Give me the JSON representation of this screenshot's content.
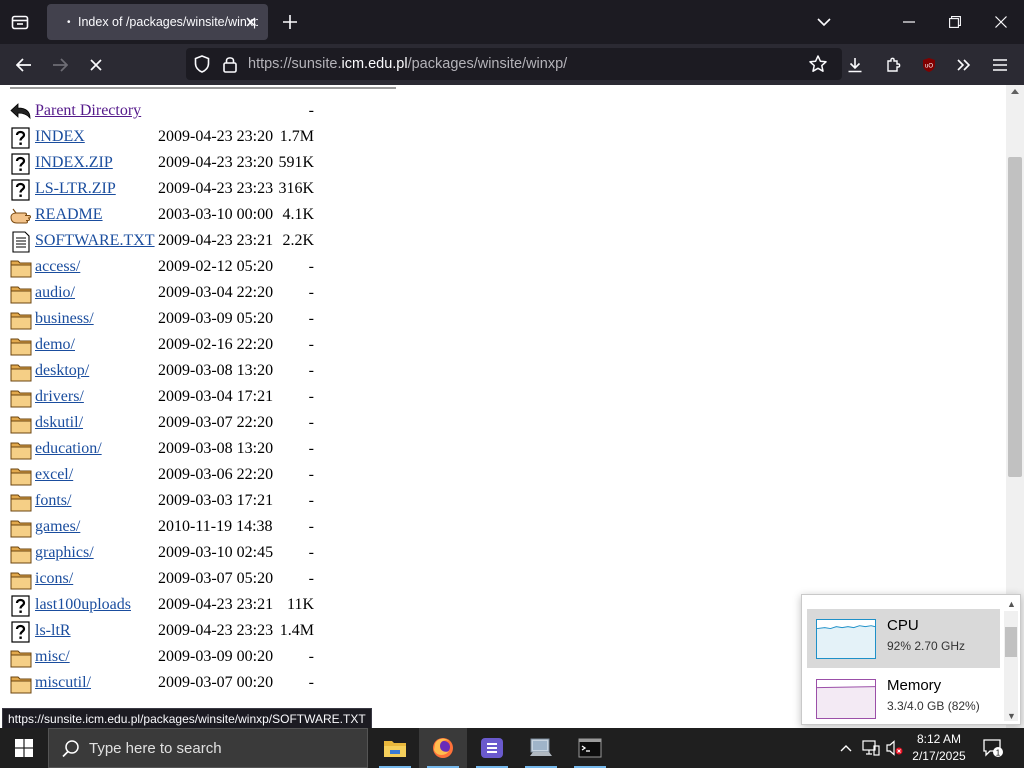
{
  "browser": {
    "tab_title": "Index of /packages/winsite/winxp/",
    "url_prefix": "https://sunsite.",
    "url_host": "icm.edu.pl",
    "url_path": "/packages/winsite/winxp/",
    "status_link": "https://sunsite.icm.edu.pl/packages/winsite/winxp/SOFTWARE.TXT"
  },
  "listing": {
    "parent_label": "Parent Directory",
    "parent_size": "-",
    "rows": [
      {
        "icon": "unknown",
        "name": "INDEX",
        "date": "2009-04-23 23:20",
        "size": "1.7M"
      },
      {
        "icon": "unknown",
        "name": "INDEX.ZIP",
        "date": "2009-04-23 23:20",
        "size": "591K"
      },
      {
        "icon": "unknown",
        "name": "LS-LTR.ZIP",
        "date": "2009-04-23 23:23",
        "size": "316K"
      },
      {
        "icon": "hand",
        "name": "README",
        "date": "2003-03-10 00:00",
        "size": "4.1K"
      },
      {
        "icon": "text",
        "name": "SOFTWARE.TXT",
        "date": "2009-04-23 23:21",
        "size": "2.2K"
      },
      {
        "icon": "folder",
        "name": "access/",
        "date": "2009-02-12 05:20",
        "size": "-"
      },
      {
        "icon": "folder",
        "name": "audio/",
        "date": "2009-03-04 22:20",
        "size": "-"
      },
      {
        "icon": "folder",
        "name": "business/",
        "date": "2009-03-09 05:20",
        "size": "-"
      },
      {
        "icon": "folder",
        "name": "demo/",
        "date": "2009-02-16 22:20",
        "size": "-"
      },
      {
        "icon": "folder",
        "name": "desktop/",
        "date": "2009-03-08 13:20",
        "size": "-"
      },
      {
        "icon": "folder",
        "name": "drivers/",
        "date": "2009-03-04 17:21",
        "size": "-"
      },
      {
        "icon": "folder",
        "name": "dskutil/",
        "date": "2009-03-07 22:20",
        "size": "-"
      },
      {
        "icon": "folder",
        "name": "education/",
        "date": "2009-03-08 13:20",
        "size": "-"
      },
      {
        "icon": "folder",
        "name": "excel/",
        "date": "2009-03-06 22:20",
        "size": "-"
      },
      {
        "icon": "folder",
        "name": "fonts/",
        "date": "2009-03-03 17:21",
        "size": "-"
      },
      {
        "icon": "folder",
        "name": "games/",
        "date": "2010-11-19 14:38",
        "size": "-"
      },
      {
        "icon": "folder",
        "name": "graphics/",
        "date": "2009-03-10 02:45",
        "size": "-"
      },
      {
        "icon": "folder",
        "name": "icons/",
        "date": "2009-03-07 05:20",
        "size": "-"
      },
      {
        "icon": "unknown",
        "name": "last100uploads",
        "date": "2009-04-23 23:21",
        "size": "11K"
      },
      {
        "icon": "unknown",
        "name": "ls-ltR",
        "date": "2009-04-23 23:23",
        "size": "1.4M"
      },
      {
        "icon": "folder",
        "name": "misc/",
        "date": "2009-03-09 00:20",
        "size": "-"
      },
      {
        "icon": "folder",
        "name": "miscutil/",
        "date": "2009-03-07 00:20",
        "size": "-"
      }
    ]
  },
  "perf": {
    "cpu_title": "CPU",
    "cpu_sub": "92%  2.70 GHz",
    "cpu_color": "#1e90c8",
    "mem_title": "Memory",
    "mem_sub": "3.3/4.0 GB (82%)",
    "mem_color": "#9b4fa8"
  },
  "taskbar": {
    "search_placeholder": "Type here to search",
    "time": "8:12 AM",
    "date": "2/17/2025",
    "notification_count": "1"
  }
}
